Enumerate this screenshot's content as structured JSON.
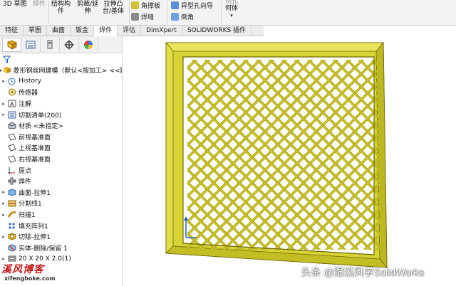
{
  "ribbon": {
    "sketch3d": "3D 草图",
    "weldment": "焊件",
    "structural_member": [
      "结构构",
      "件"
    ],
    "trim_extend": [
      "剪裁/延",
      "伸"
    ],
    "extrude_boss": [
      "拉伸凸",
      "台/基体"
    ],
    "gusset": "角撑板",
    "weld_bead": "焊缝",
    "hole_wizard": "异型孔向导",
    "chamfer": "倒角",
    "cut_body": [
      "何体",
      "▾"
    ],
    "cut_body_top": "切孔"
  },
  "tabs": [
    "特征",
    "草图",
    "曲面",
    "钣金",
    "焊件",
    "评估",
    "DimXpert",
    "SOLIDWORKS 插件"
  ],
  "active_tab": "焊件",
  "tree": {
    "root": "菱形钢丝网建模（默认<按加工> <<默认>",
    "items": [
      {
        "label": "History",
        "icon": "history-icon",
        "expandable": true
      },
      {
        "label": "传感器",
        "icon": "sensor-icon",
        "expandable": false
      },
      {
        "label": "注解",
        "icon": "annotation-icon",
        "expandable": true
      },
      {
        "label": "切割清单(200)",
        "icon": "cut-list-icon",
        "expandable": true
      },
      {
        "label": "材质 <未指定>",
        "icon": "material-icon",
        "expandable": false
      },
      {
        "label": "前视基准面",
        "icon": "plane-icon",
        "expandable": false
      },
      {
        "label": "上视基准面",
        "icon": "plane-icon",
        "expandable": false
      },
      {
        "label": "右视基准面",
        "icon": "plane-icon",
        "expandable": false
      },
      {
        "label": "原点",
        "icon": "origin-icon",
        "expandable": false
      },
      {
        "label": "焊件",
        "icon": "weldment-icon",
        "expandable": false
      },
      {
        "label": "曲面-拉伸1",
        "icon": "surface-extrude-icon",
        "expandable": true
      },
      {
        "label": "分割线1",
        "icon": "split-line-icon",
        "expandable": true
      },
      {
        "label": "扫描1",
        "icon": "sweep-icon",
        "expandable": true
      },
      {
        "label": "填充阵列1",
        "icon": "fill-pattern-icon",
        "expandable": false
      },
      {
        "label": "切除-拉伸1",
        "icon": "cut-extrude-icon",
        "expandable": true
      },
      {
        "label": "实体-删除/保留 1",
        "icon": "delete-body-icon",
        "expandable": false
      },
      {
        "label": "20 X 20 X 2.0(1)",
        "icon": "structural-member-icon",
        "expandable": true
      }
    ]
  },
  "watermark": {
    "logo": "溪风博客",
    "url": "xifengboke.com",
    "right": "头条 @跟溪风学SolidWorks"
  },
  "colors": {
    "frame": "#d8d235",
    "frame_dark": "#a9a313",
    "mesh": "#c9c22b",
    "accent": "#1f5fbf"
  }
}
